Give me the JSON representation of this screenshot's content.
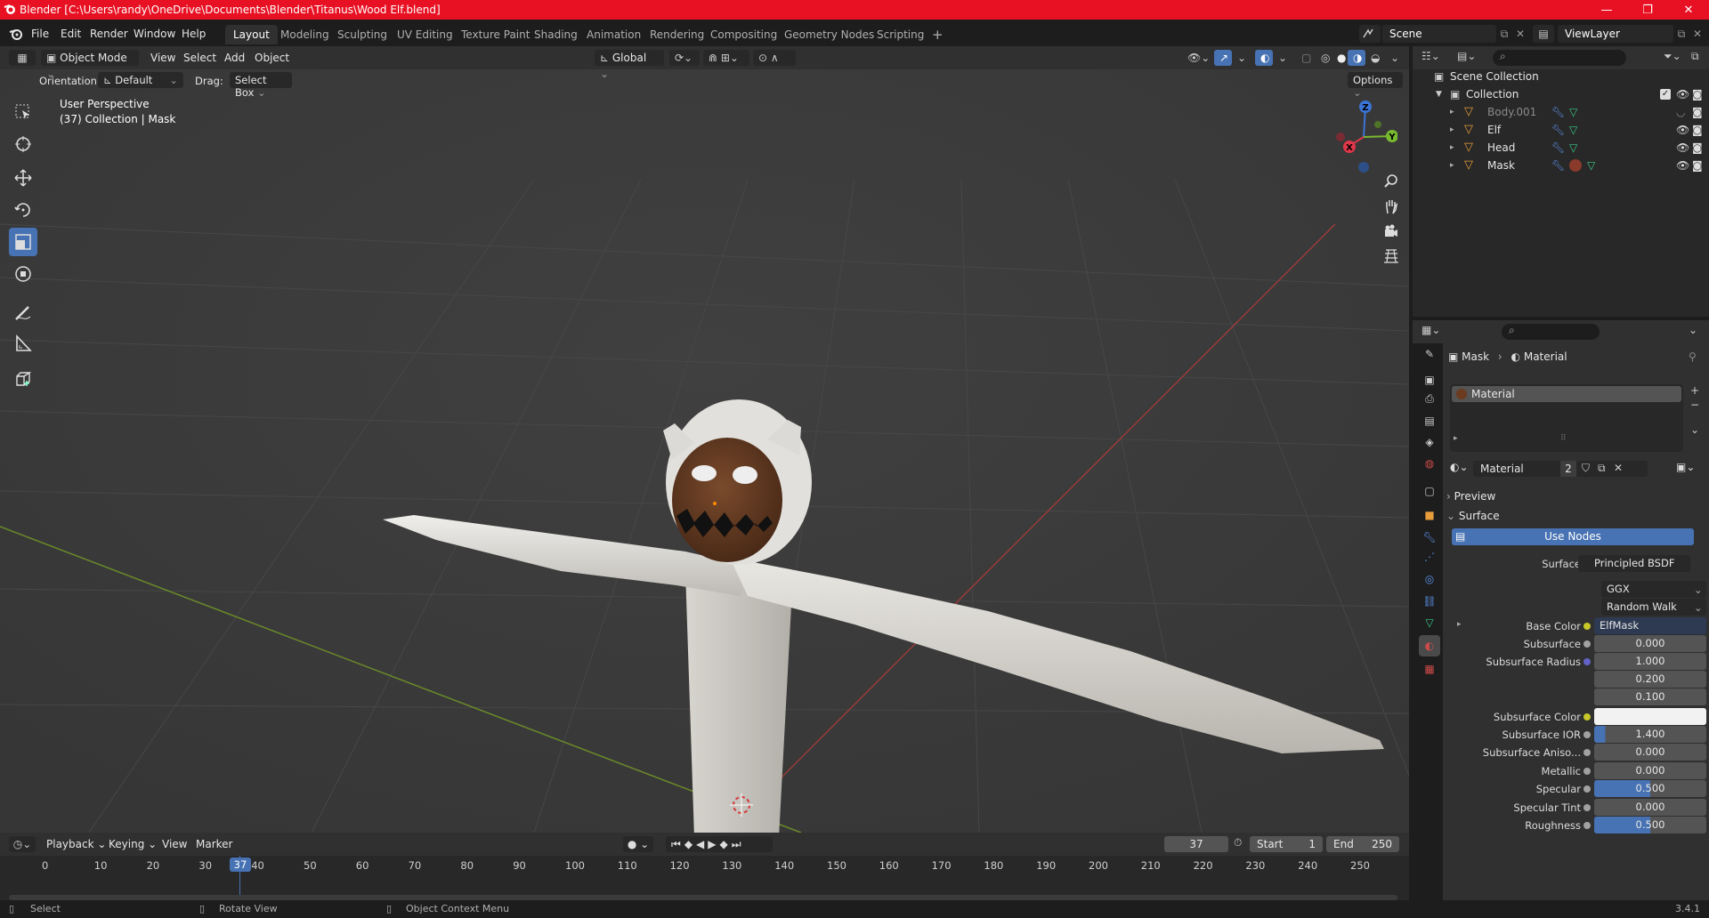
{
  "window": {
    "title": "Blender [C:\\Users\\randy\\OneDrive\\Documents\\Blender\\Titanus\\Wood Elf.blend]",
    "accent": "#e81123",
    "controls": [
      "—",
      "❐",
      "✕"
    ]
  },
  "menus": [
    "File",
    "Edit",
    "Render",
    "Window",
    "Help"
  ],
  "workspaces": [
    "Layout",
    "Modeling",
    "Sculpting",
    "UV Editing",
    "Texture Paint",
    "Shading",
    "Animation",
    "Rendering",
    "Compositing",
    "Geometry Nodes",
    "Scripting"
  ],
  "active_workspace": "Layout",
  "scene": {
    "label": "Scene",
    "viewlayer": "ViewLayer"
  },
  "viewport_header": {
    "mode": "Object Mode",
    "menus": [
      "View",
      "Select",
      "Add",
      "Object"
    ],
    "transform": "Global",
    "orientation_label": "Orientation:",
    "orientation_value": "Default",
    "drag_label": "Drag:",
    "drag_value": "Select Box",
    "options": "Options"
  },
  "viewport": {
    "perspective": "User Perspective",
    "collection_info": "(37) Collection | Mask",
    "gizmo_axes": [
      "Z",
      "X",
      "Y"
    ]
  },
  "timeline": {
    "menus": [
      "Playback",
      "Keying",
      "View",
      "Marker"
    ],
    "current_frame": "37",
    "start_label": "Start",
    "start": "1",
    "end_label": "End",
    "end": "250",
    "ticks": [
      "0",
      "10",
      "20",
      "30",
      "40",
      "50",
      "60",
      "70",
      "80",
      "90",
      "100",
      "110",
      "120",
      "130",
      "140",
      "150",
      "160",
      "170",
      "180",
      "190",
      "200",
      "210",
      "220",
      "230",
      "240",
      "250"
    ]
  },
  "statusbar": {
    "items": [
      "Select",
      "Rotate View",
      "Object Context Menu"
    ],
    "version": "3.4.1"
  },
  "outliner": {
    "root": "Scene Collection",
    "collection": "Collection",
    "objects": [
      {
        "name": "Body.001",
        "dimmed": true
      },
      {
        "name": "Elf",
        "dimmed": false
      },
      {
        "name": "Head",
        "dimmed": false
      },
      {
        "name": "Mask",
        "dimmed": false
      }
    ]
  },
  "properties": {
    "breadcrumb_object": "Mask",
    "breadcrumb_material": "Material",
    "slot_name": "Material",
    "material_name": "Material",
    "users": "2",
    "panels": {
      "preview": "Preview",
      "surface": "Surface"
    },
    "use_nodes": "Use Nodes",
    "surface_label": "Surface",
    "surface_value": "Principled BSDF",
    "distribution": "GGX",
    "subsurface_method": "Random Walk",
    "base_color_label": "Base Color",
    "base_color_value": "ElfMask",
    "rows": [
      {
        "label": "Subsurface",
        "value": "0.000",
        "fill": 0
      },
      {
        "label": "Subsurface Radius",
        "value": "1.000",
        "fill": 0
      },
      {
        "label": "",
        "value": "0.200",
        "fill": 0
      },
      {
        "label": "",
        "value": "0.100",
        "fill": 0
      },
      {
        "label": "Subsurface Color",
        "value": "",
        "fill": 0
      },
      {
        "label": "Subsurface IOR",
        "value": "1.400",
        "fill": 0.1
      },
      {
        "label": "Subsurface Aniso...",
        "value": "0.000",
        "fill": 0
      },
      {
        "label": "Metallic",
        "value": "0.000",
        "fill": 0
      },
      {
        "label": "Specular",
        "value": "0.500",
        "fill": 0.5
      },
      {
        "label": "Specular Tint",
        "value": "0.000",
        "fill": 0
      },
      {
        "label": "Roughness",
        "value": "0.500",
        "fill": 0.5
      }
    ]
  }
}
